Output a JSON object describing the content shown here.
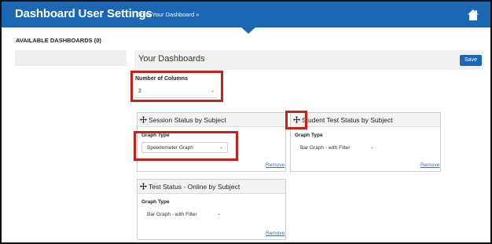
{
  "header": {
    "title": "Dashboard User Settings",
    "link": "Go to Your Dashboard »",
    "home_icon": "home-icon"
  },
  "sidebar": {
    "available_label": "AVAILABLE DASHBOARDS (0)"
  },
  "main": {
    "title": "Your Dashboards",
    "save_label": "Save",
    "columns": {
      "label": "Number of Columns",
      "value": "2"
    }
  },
  "cards": [
    {
      "title": "Session Status by Subject",
      "graph_type_label": "Graph Type",
      "graph_type_value": "Speedometer Graph",
      "remove_label": "Remove"
    },
    {
      "title": "Student Test Status by Subject",
      "graph_type_label": "Graph Type",
      "graph_type_value": "Bar Graph - with Filter",
      "remove_label": "Remove"
    },
    {
      "title": "Test Status - Online by Subject",
      "graph_type_label": "Graph Type",
      "graph_type_value": "Bar Graph - with Filter",
      "remove_label": "Remove"
    }
  ],
  "colors": {
    "header_blue": "#1b67b3",
    "highlight_red": "#c8201b",
    "link_blue": "#3b6fb8"
  }
}
